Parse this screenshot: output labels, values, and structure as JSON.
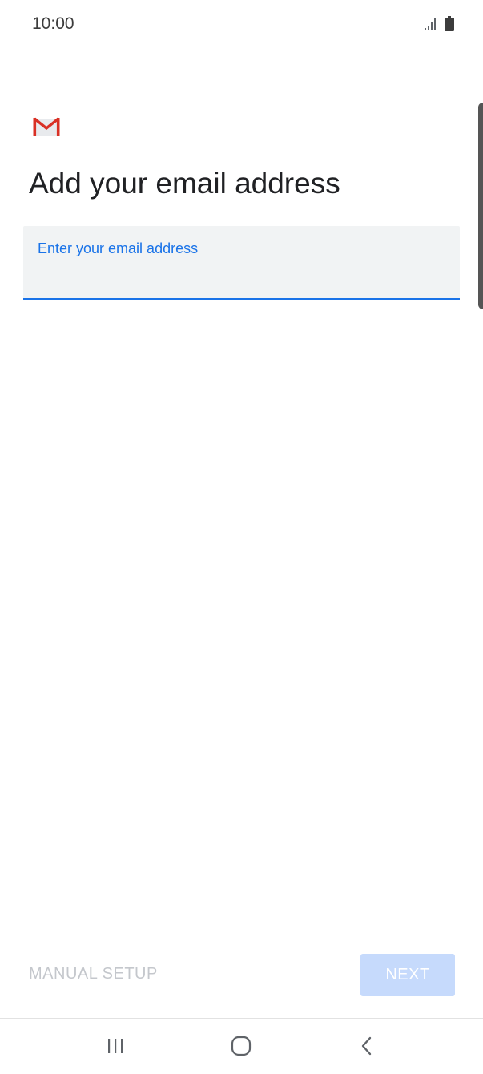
{
  "status_bar": {
    "time": "10:00",
    "icons": [
      "signal-icon",
      "battery-icon"
    ]
  },
  "logo": {
    "icon": "gmail-icon",
    "colors": {
      "red": "#d93025",
      "fold": "#c5221f",
      "envelope": "#e8eaed"
    }
  },
  "page": {
    "title": "Add your email address"
  },
  "email_field": {
    "label": "Enter your email address",
    "value": "",
    "accent_color": "#1a73e8"
  },
  "actions": {
    "manual_setup_label": "MANUAL SETUP",
    "next_label": "NEXT"
  },
  "nav_bar": {
    "buttons": [
      "recents-icon",
      "home-icon",
      "back-icon"
    ]
  }
}
